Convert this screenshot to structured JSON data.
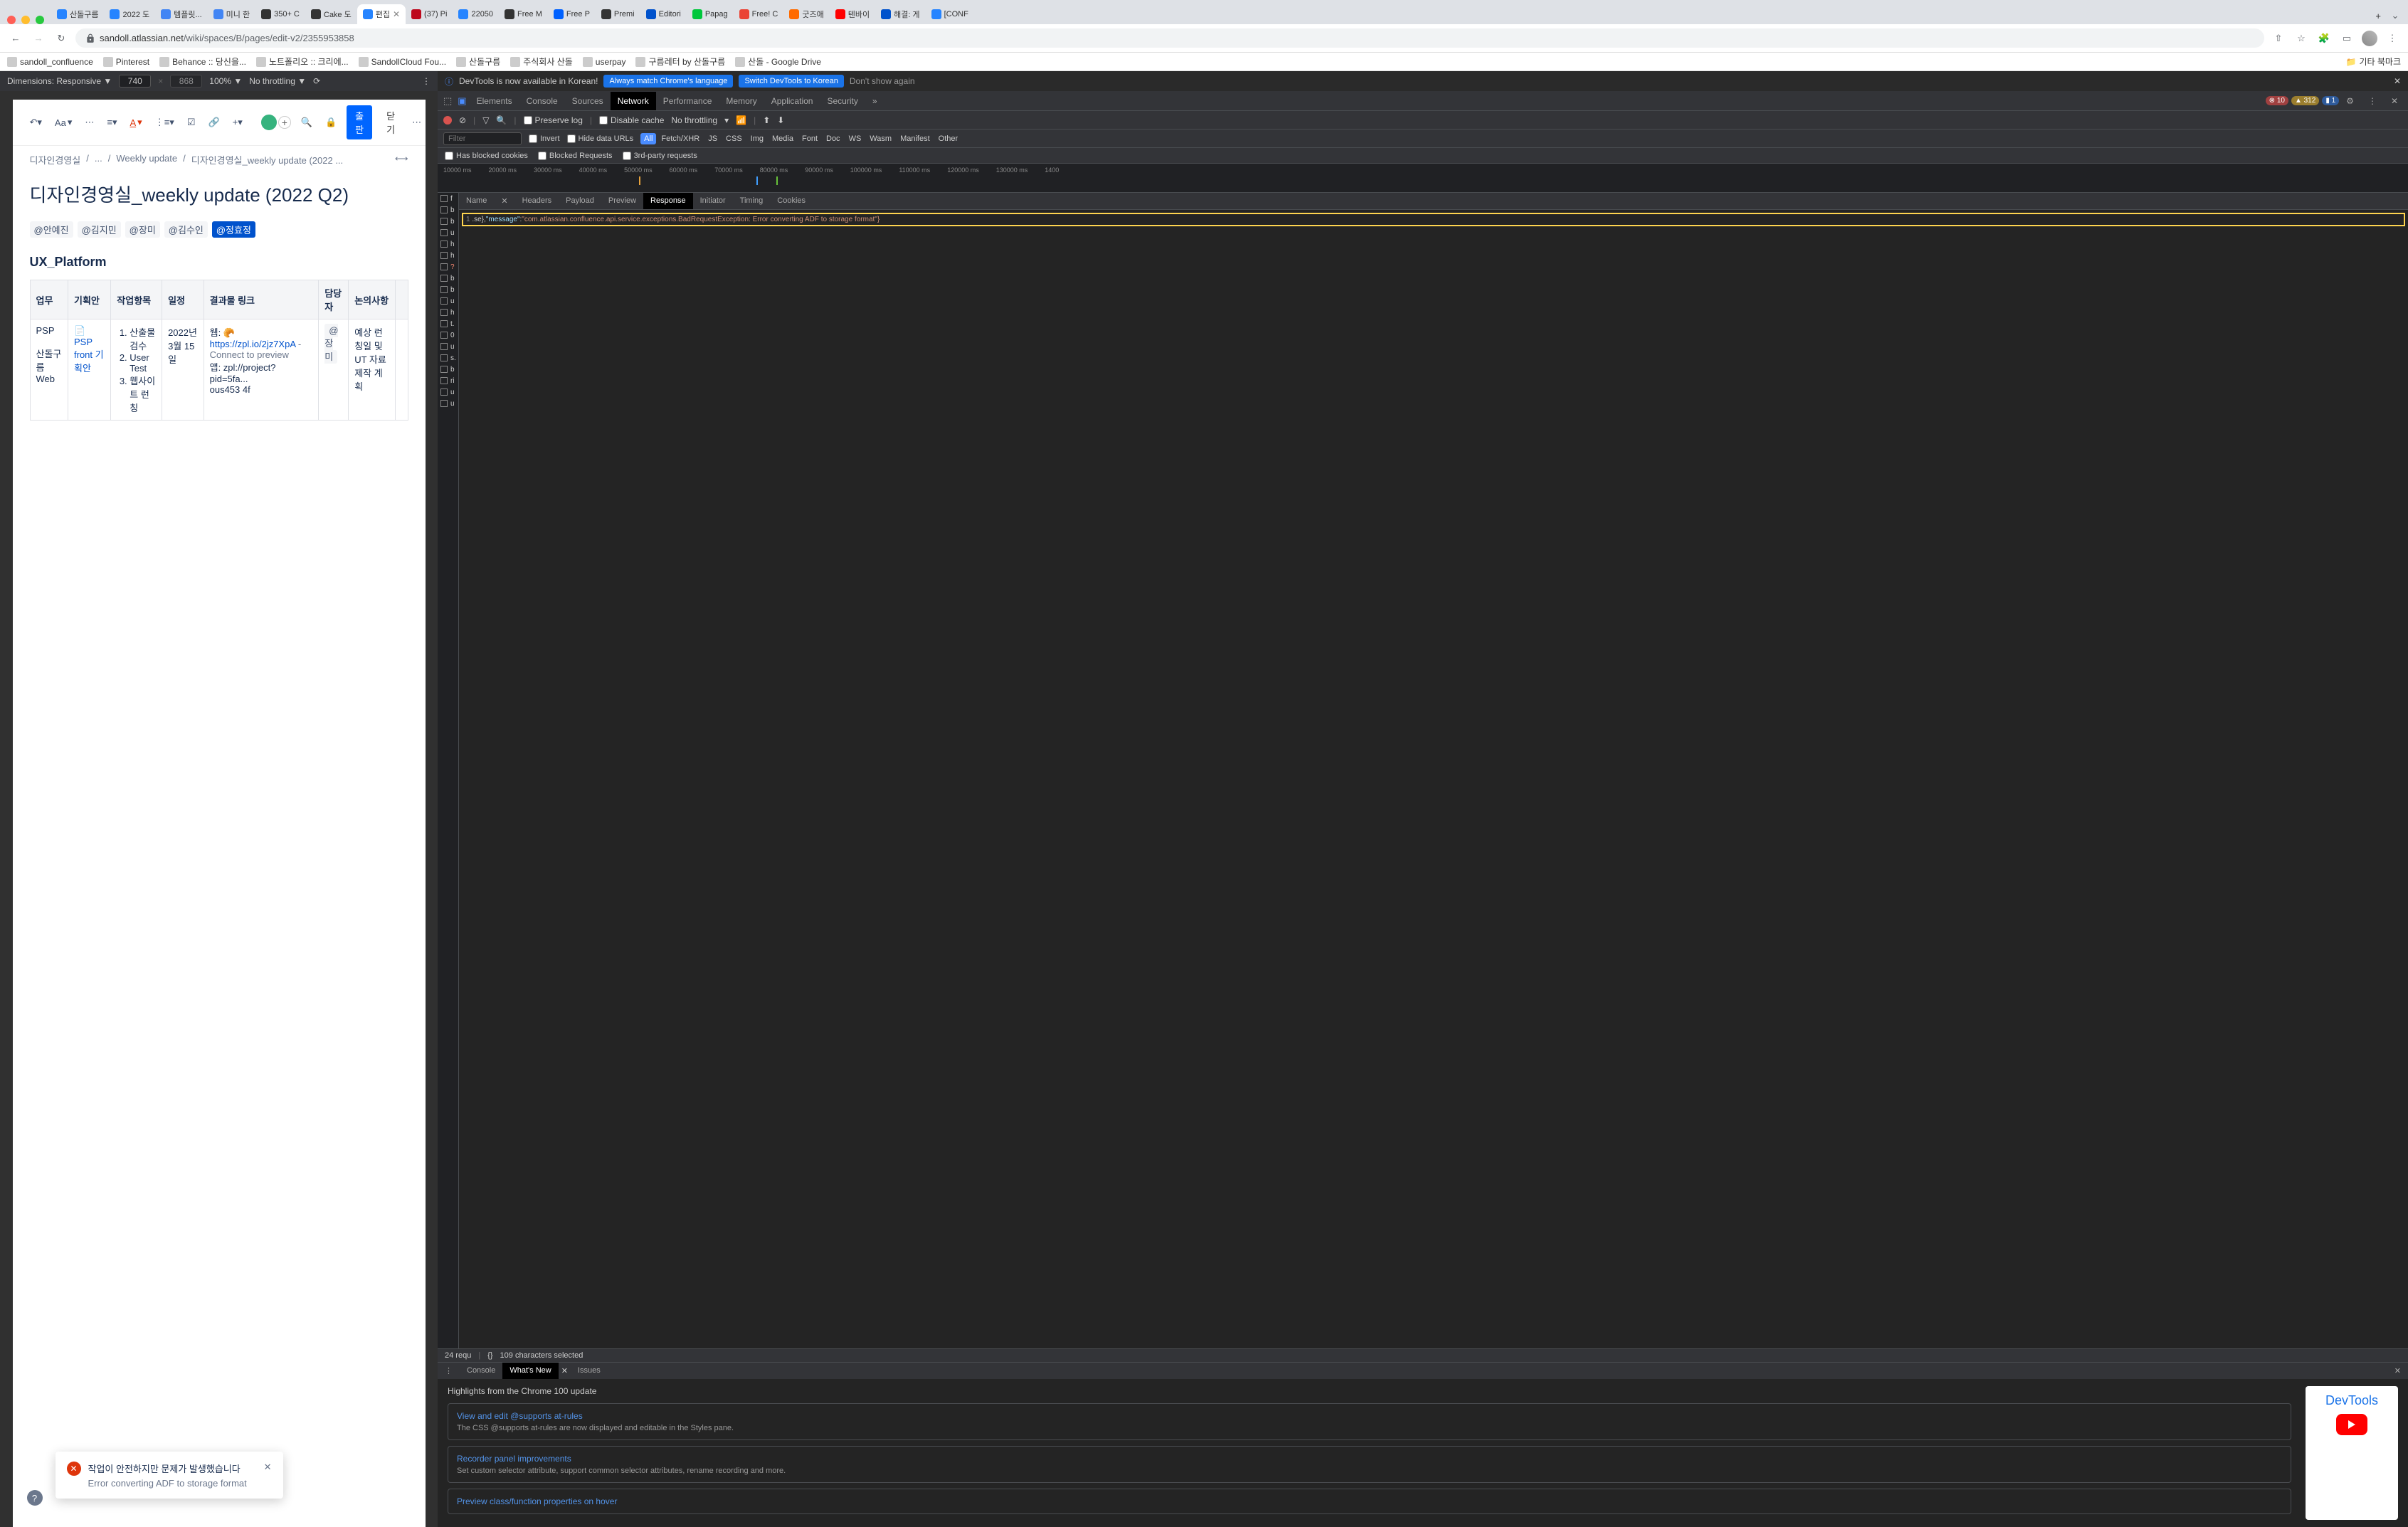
{
  "window": {
    "tabs": [
      {
        "favicon": "#2684ff",
        "title": "산돌구름"
      },
      {
        "favicon": "#2684ff",
        "title": "2022 도"
      },
      {
        "favicon": "#4285f4",
        "title": "템플릿..."
      },
      {
        "favicon": "#4285f4",
        "title": "미니 한"
      },
      {
        "favicon": "#333",
        "title": "350+ C"
      },
      {
        "favicon": "#333",
        "title": "Cake 도"
      },
      {
        "favicon": "#2684ff",
        "title": "편집",
        "active": true
      },
      {
        "favicon": "#bd081c",
        "title": "(37) Pi"
      },
      {
        "favicon": "#2684ff",
        "title": "22050"
      },
      {
        "favicon": "#333",
        "title": "Free M"
      },
      {
        "favicon": "#0061ff",
        "title": "Free P"
      },
      {
        "favicon": "#333",
        "title": "Premi"
      },
      {
        "favicon": "#0052cc",
        "title": "Editori"
      },
      {
        "favicon": "#00c73c",
        "title": "Papag"
      },
      {
        "favicon": "#ea4335",
        "title": "Free! C"
      },
      {
        "favicon": "#ff6b00",
        "title": "굿즈애"
      },
      {
        "favicon": "#ff0000",
        "title": "텐바이"
      },
      {
        "favicon": "#0052cc",
        "title": "해결: 게"
      },
      {
        "favicon": "#2684ff",
        "title": "[CONF"
      }
    ],
    "url_host": "sandoll.atlassian.net",
    "url_path": "/wiki/spaces/B/pages/edit-v2/2355953858",
    "bookmarks": [
      "sandoll_confluence",
      "Pinterest",
      "Behance :: 당신을...",
      "노트폴리오 :: 크리에...",
      "SandollCloud Fou...",
      "산돌구름",
      "주식회사 산돌",
      "userpay",
      "구름레터 by 산돌구름",
      "산돌 - Google Drive"
    ],
    "bookmark_folder": "기타 북마크"
  },
  "device_bar": {
    "dimensions_label": "Dimensions: Responsive ▼",
    "width": "740",
    "height": "868",
    "zoom": "100% ▼",
    "throttle": "No throttling ▼"
  },
  "confluence": {
    "toolbar": {
      "publish": "출판",
      "close": "닫기",
      "text_style": "Aa"
    },
    "breadcrumb": [
      "디자인경영실",
      "...",
      "Weekly update",
      "디자인경영실_weekly update (2022 ..."
    ],
    "title": "디자인경영실_weekly update (2022 Q2)",
    "mentions": [
      "@안예진",
      "@김지민",
      "@장미",
      "@김수인",
      "@정효정"
    ],
    "active_mention": 4,
    "section": "UX_Platform",
    "table": {
      "headers": [
        "업무",
        "기획안",
        "작업항목",
        "일정",
        "결과물 링크",
        "담당자",
        "논의사항",
        ""
      ],
      "row": {
        "col1_a": "PSP",
        "col1_b": "산돌구름 Web",
        "col2_icon": "📄",
        "col2_link": "PSP front 기획안",
        "col3": [
          "산출물 검수",
          "User Test",
          "웹사이트 런칭"
        ],
        "col4": "2022년 3월 15일",
        "col5_label": "웹: ",
        "col5_emoji": "🥐",
        "col5_link": "https://zpl.io/2jz7XpA",
        "col5_suffix": " - Connect to preview",
        "col5_b": "앱: zpl://project?pid=5fa...",
        "col5_c": "ous453 4f",
        "col6": "@장미",
        "col7": "예상 런칭일 및 UT 자료 제작 계획"
      }
    },
    "error_toast": {
      "title": "작업이 안전하지만 문제가 발생했습니다",
      "body": "Error converting ADF to storage format"
    }
  },
  "devtools": {
    "banner": {
      "text": "DevTools is now available in Korean!",
      "btn1": "Always match Chrome's language",
      "btn2": "Switch DevTools to Korean",
      "dismiss": "Don't show again"
    },
    "tabs": [
      "Elements",
      "Console",
      "Sources",
      "Network",
      "Performance",
      "Memory",
      "Application",
      "Security"
    ],
    "active_tab": 3,
    "badges": {
      "errors": "10",
      "warnings": "312",
      "info": "1"
    },
    "filter": {
      "preserve_log": "Preserve log",
      "disable_cache": "Disable cache",
      "throttle": "No throttling"
    },
    "filter2": {
      "placeholder": "Filter",
      "invert": "Invert",
      "hide_data": "Hide data URLs",
      "types": [
        "All",
        "Fetch/XHR",
        "JS",
        "CSS",
        "Img",
        "Media",
        "Font",
        "Doc",
        "WS",
        "Wasm",
        "Manifest",
        "Other"
      ]
    },
    "checkboxes": [
      "Has blocked cookies",
      "Blocked Requests",
      "3rd-party requests"
    ],
    "timeline_labels": [
      "10000 ms",
      "20000 ms",
      "30000 ms",
      "40000 ms",
      "50000 ms",
      "60000 ms",
      "70000 ms",
      "80000 ms",
      "90000 ms",
      "100000 ms",
      "110000 ms",
      "120000 ms",
      "130000 ms",
      "1400"
    ],
    "request_list": [
      "f",
      "b",
      "b",
      "u",
      "h",
      "h",
      "?",
      "b",
      "b",
      "u",
      "h",
      "t.",
      "0",
      "u",
      "s.",
      "b",
      "ri",
      "u",
      "u"
    ],
    "request_error_idx": 6,
    "resp_tabs": [
      "Name",
      "Headers",
      "Payload",
      "Preview",
      "Response",
      "Initiator",
      "Timing",
      "Cookies"
    ],
    "resp_active": 4,
    "response_line_num": "1",
    "response_prefix": ".se},",
    "response_key": "\"message\"",
    "response_colon": ":",
    "response_value": "\"com.atlassian.confluence.api.service.exceptions.BadRequestException: Error converting ADF to storage format\"}",
    "status": {
      "reqs": "24 requ",
      "selected": "109 characters selected"
    },
    "drawer": {
      "tabs": [
        "Console",
        "What's New",
        "Issues"
      ],
      "active": 1,
      "heading": "Highlights from the Chrome 100 update",
      "cards": [
        {
          "title": "View and edit @supports at-rules",
          "body": "The CSS @supports at-rules are now displayed and editable in the Styles pane."
        },
        {
          "title": "Recorder panel improvements",
          "body": "Set custom selector attribute, support common selector attributes, rename recording and more."
        },
        {
          "title": "Preview class/function properties on hover",
          "body": ""
        }
      ],
      "promo": "DevTools"
    }
  }
}
